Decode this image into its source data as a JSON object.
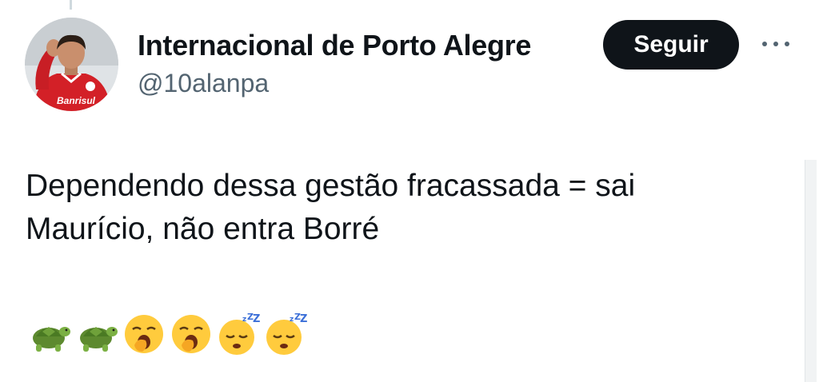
{
  "tweet": {
    "display_name": "Internacional de Porto Alegre",
    "handle": "@10alanpa",
    "follow_label": "Seguir",
    "text_line1": "Dependendo dessa gestão fracassada = sai",
    "text_line2": "Maurício, não entra Borré",
    "avatar_badge": "Banrisul",
    "emojis": [
      "turtle",
      "turtle",
      "yawning-face",
      "yawning-face",
      "sleeping-face",
      "sleeping-face"
    ]
  },
  "colors": {
    "text": "#0f1419",
    "secondary_text": "#536471",
    "follow_button_bg": "#0f1419",
    "follow_button_text": "#ffffff",
    "jersey_red": "#d32027"
  },
  "icons": {
    "more": "more-horizontal-icon"
  }
}
